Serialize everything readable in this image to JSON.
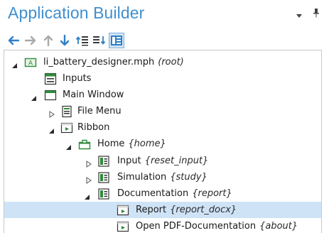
{
  "panel": {
    "title": "Application Builder"
  },
  "toolbar": {
    "buttons": [
      {
        "name": "back-arrow-icon"
      },
      {
        "name": "forward-arrow-icon"
      },
      {
        "name": "move-up-icon"
      },
      {
        "name": "move-down-icon"
      },
      {
        "name": "collapse-all-icon"
      },
      {
        "name": "expand-all-icon"
      },
      {
        "name": "tree-view-icon"
      }
    ]
  },
  "colors": {
    "title": "#3f8fcf",
    "accent": "#2f7fc6",
    "selection": "#cfe3f7",
    "icon_green": "#2e8b3a"
  },
  "tree": {
    "nodes": [
      {
        "label": "li_battery_designer.mph",
        "tag": "(root)",
        "state": "expanded",
        "icon": "application-icon"
      },
      {
        "label": "Inputs",
        "tag": "",
        "state": "leaf",
        "icon": "inputs-icon"
      },
      {
        "label": "Main Window",
        "tag": "",
        "state": "expanded",
        "icon": "main-window-icon"
      },
      {
        "label": "File Menu",
        "tag": "",
        "state": "collapsed",
        "icon": "file-menu-icon"
      },
      {
        "label": "Ribbon",
        "tag": "",
        "state": "expanded",
        "icon": "ribbon-icon"
      },
      {
        "label": "Home",
        "tag": "{home}",
        "state": "expanded",
        "icon": "ribbon-tab-icon"
      },
      {
        "label": "Input",
        "tag": "{reset_input}",
        "state": "collapsed",
        "icon": "ribbon-section-icon"
      },
      {
        "label": "Simulation",
        "tag": "{study}",
        "state": "collapsed",
        "icon": "ribbon-section-icon"
      },
      {
        "label": "Documentation",
        "tag": "{report}",
        "state": "expanded",
        "icon": "ribbon-section-icon"
      },
      {
        "label": "Report",
        "tag": "{report_docx}",
        "state": "leaf",
        "icon": "ribbon-item-icon",
        "selected": true
      },
      {
        "label": "Open PDF-Documentation",
        "tag": "{about}",
        "state": "leaf",
        "icon": "ribbon-item-icon"
      }
    ]
  }
}
